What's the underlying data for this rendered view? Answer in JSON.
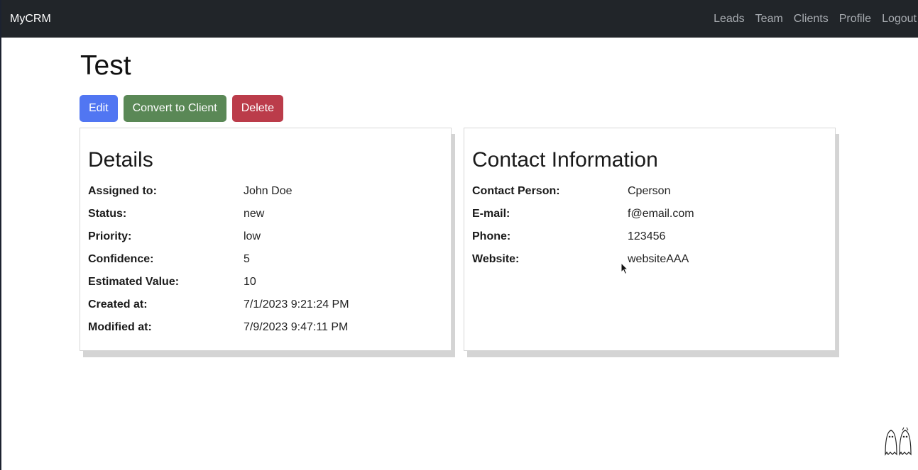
{
  "nav": {
    "brand": "MyCRM",
    "links": [
      "Leads",
      "Team",
      "Clients",
      "Profile",
      "Logout"
    ]
  },
  "lead": {
    "title": "Test"
  },
  "actions": {
    "edit": "Edit",
    "convert": "Convert to Client",
    "delete": "Delete"
  },
  "details": {
    "heading": "Details",
    "rows": [
      {
        "label": "Assigned to:",
        "value": "John Doe"
      },
      {
        "label": "Status:",
        "value": "new"
      },
      {
        "label": "Priority:",
        "value": "low"
      },
      {
        "label": "Confidence:",
        "value": "5"
      },
      {
        "label": "Estimated Value:",
        "value": "10"
      },
      {
        "label": "Created at:",
        "value": "7/1/2023 9:21:24 PM"
      },
      {
        "label": "Modified at:",
        "value": "7/9/2023 9:47:11 PM"
      }
    ]
  },
  "contact": {
    "heading": "Contact Information",
    "rows": [
      {
        "label": "Contact Person:",
        "value": "Cperson"
      },
      {
        "label": "E-mail:",
        "value": "f@email.com"
      },
      {
        "label": "Phone:",
        "value": "123456"
      },
      {
        "label": "Website:",
        "value": "websiteAAA"
      }
    ]
  },
  "colors": {
    "navbar": "#212529",
    "edit": "#5176f2",
    "convert": "#5a8856",
    "delete": "#bb3c4a"
  }
}
